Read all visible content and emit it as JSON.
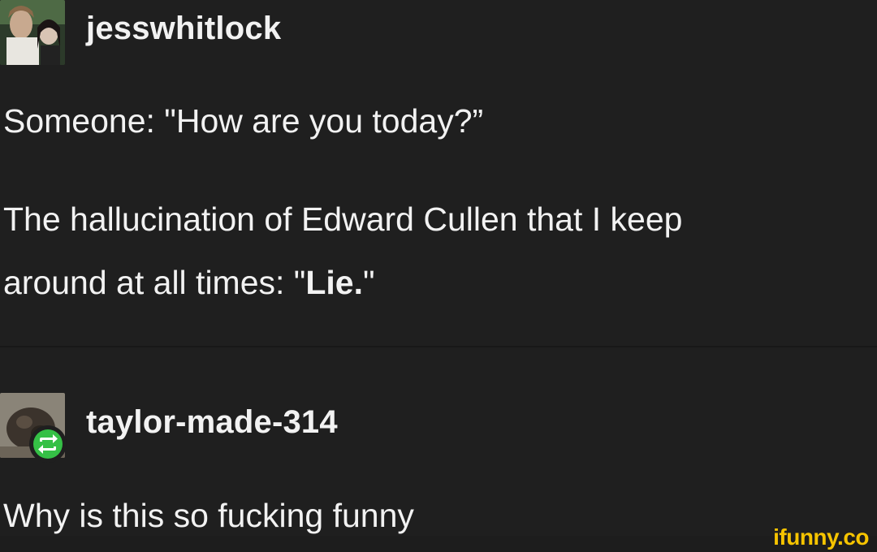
{
  "posts": [
    {
      "username": "jesswhitlock",
      "lines": [
        "Someone: \"How are you today?”",
        "The hallucination of Edward Cullen that I keep",
        "around at all times: \""
      ],
      "emphasis": "Lie.",
      "closing_quote": "\""
    },
    {
      "username": "taylor-made-314",
      "lines": [
        "Why is this so fucking funny"
      ]
    }
  ],
  "watermark": "ifunny.co",
  "colors": {
    "background": "#1f1f1f",
    "text": "#f2f2f2",
    "reblog_badge": "#35c046",
    "watermark": "#f6c400"
  },
  "icons": {
    "reblog": "reblog-icon"
  }
}
